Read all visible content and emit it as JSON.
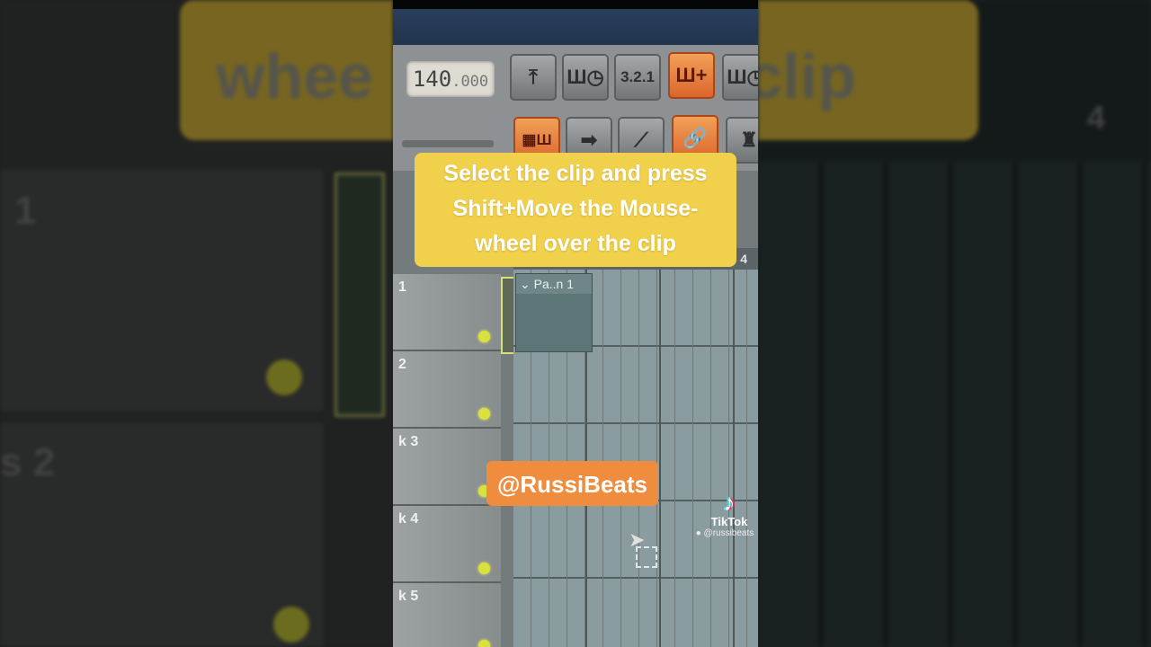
{
  "toolbar": {
    "tempo_main": "140",
    "tempo_decimal": ".000",
    "buttons_row1": [
      "metronome-icon",
      "wait-icon",
      "countdown-icon",
      "step-edit-icon",
      "recording-icon"
    ],
    "buttons_row1_labels": [
      "⤒",
      "Ш◷",
      "3.2.1",
      "Ш+",
      "Ш◷"
    ],
    "buttons_row2_labels": [
      "▦Ш",
      "➡",
      "⟋",
      "🔗",
      "♜"
    ]
  },
  "playlist": {
    "ruler_bar": "4",
    "tracks": [
      {
        "label": "1"
      },
      {
        "label": "2"
      },
      {
        "label": "k 3"
      },
      {
        "label": "k 4"
      },
      {
        "label": "k 5"
      }
    ],
    "clip_name": "Pa..n 1"
  },
  "overlay": {
    "caption_lines": [
      "Select the clip and press",
      "Shift+Move the Mouse-",
      "wheel over the clip"
    ],
    "handle": "@RussiBeats",
    "tiktok_name": "TikTok",
    "tiktok_user": "@russibeats"
  },
  "background": {
    "left_caption": "whee",
    "right_caption": "e clip",
    "left_track_1": "1",
    "left_track_2": "s 2",
    "right_bar": "4"
  },
  "colors": {
    "caption_bg": "#f1d04b",
    "handle_bg": "#f08c3e",
    "active_button": "#e07a35",
    "mute_dot": "#d8e23a"
  }
}
